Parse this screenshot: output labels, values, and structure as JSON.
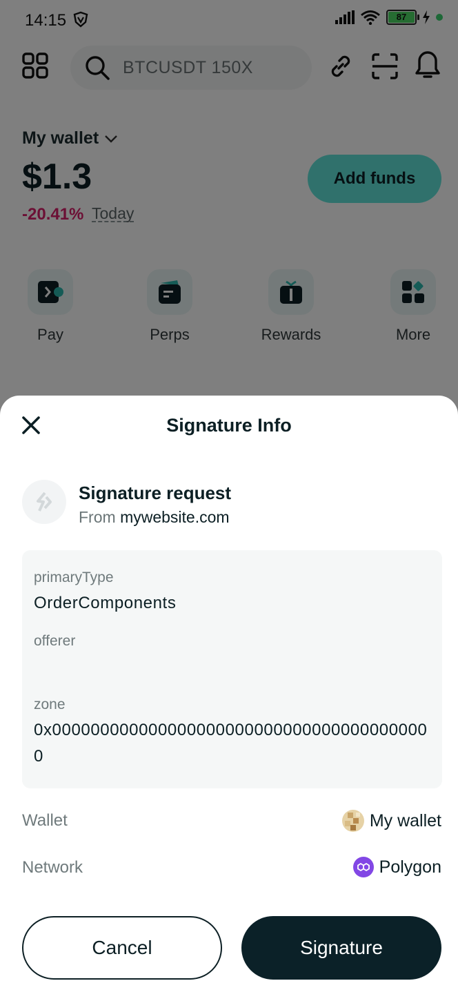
{
  "status_bar": {
    "time": "14:15",
    "battery": "87"
  },
  "header": {
    "search_placeholder": "BTCUSDT 150X"
  },
  "wallet": {
    "label": "My wallet",
    "balance": "$1.3",
    "change": "-20.41%",
    "period": "Today",
    "add_funds_label": "Add funds"
  },
  "quick_actions": [
    {
      "label": "Pay",
      "icon": "pay-icon"
    },
    {
      "label": "Perps",
      "icon": "perps-icon"
    },
    {
      "label": "Rewards",
      "icon": "gift-icon"
    },
    {
      "label": "More",
      "icon": "more-icon"
    }
  ],
  "sheet": {
    "title": "Signature Info",
    "request_title": "Signature request",
    "from_prefix": "From",
    "from_site": "mywebsite.com",
    "fields": [
      {
        "label": "primaryType",
        "value": "OrderComponents"
      },
      {
        "label": "offerer",
        "value": ""
      },
      {
        "label": "zone",
        "value": "0x0000000000000000000000000000000000000000"
      }
    ],
    "wallet_label": "Wallet",
    "wallet_value": "My wallet",
    "network_label": "Network",
    "network_value": "Polygon",
    "cancel_label": "Cancel",
    "sign_label": "Signature"
  },
  "colors": {
    "accent": "#60e3d9",
    "negative": "#d81f6a",
    "primary_dark": "#0b2128",
    "polygon": "#8247e5"
  }
}
